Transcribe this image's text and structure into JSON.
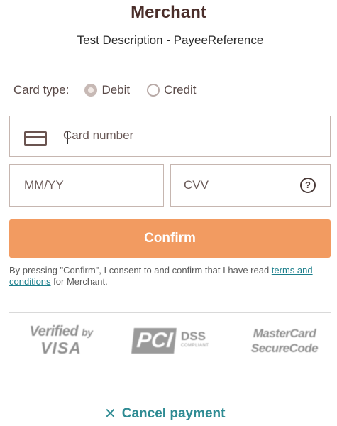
{
  "header": {
    "merchant": "Merchant",
    "description": "Test Description - PayeeReference"
  },
  "card_type": {
    "label": "Card type:",
    "options": [
      {
        "label": "Debit",
        "selected": true
      },
      {
        "label": "Credit",
        "selected": false
      }
    ]
  },
  "fields": {
    "card_number_placeholder": "Card number",
    "expiry_placeholder": "MM/YY",
    "cvv_placeholder": "CVV",
    "help_symbol": "?"
  },
  "confirm": {
    "label": "Confirm",
    "color": "#f29b61"
  },
  "consent": {
    "prefix": "By pressing \"Confirm\", I consent to and confirm that I have read ",
    "link": "terms and conditions",
    "suffix": " for Merchant."
  },
  "logos": {
    "visa_top": "Verified",
    "visa_by": "by",
    "visa_bottom": "VISA",
    "pci_main": "PCI",
    "pci_dss": "DSS",
    "pci_sub": "COMPLIANT",
    "mastercard_top": "MasterCard",
    "mastercard_bottom": "SecureCode"
  },
  "cancel": {
    "icon": "✕",
    "label": "Cancel payment",
    "color": "#2e8b93"
  }
}
